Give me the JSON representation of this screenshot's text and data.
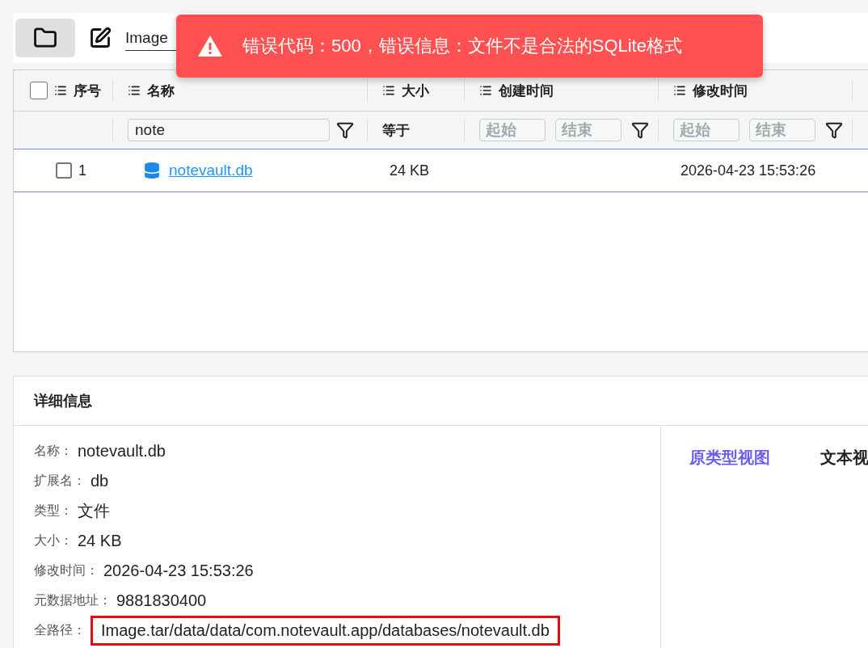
{
  "toolbar": {
    "buttons": [
      {
        "kind": "folder",
        "selected": true
      },
      {
        "kind": "edit",
        "selected": false
      }
    ],
    "path_field": {
      "value": "Image"
    }
  },
  "toast": {
    "kind": "error",
    "message": "错误代码：500，错误信息：文件不是合法的SQLite格式"
  },
  "table": {
    "select_all": {
      "checked": false
    },
    "columns": [
      {
        "label": "序号"
      },
      {
        "label": "名称"
      },
      {
        "label": "大小"
      },
      {
        "label": "创建时间"
      },
      {
        "label": "修改时间"
      }
    ],
    "filters": [
      {
        "kind": "none"
      },
      {
        "kind": "text",
        "value": "note"
      },
      {
        "kind": "label",
        "text": "等于"
      },
      {
        "kind": "range",
        "start_placeholder": "起始",
        "end_placeholder": "结束"
      },
      {
        "kind": "range",
        "start_placeholder": "起始",
        "end_placeholder": "结束"
      }
    ],
    "rows": [
      {
        "index": "1",
        "checked": false,
        "selected": true,
        "name": "notevault.db",
        "size": "24 KB",
        "modified": "2026-04-23 15:53:26"
      }
    ]
  },
  "details": {
    "title": "详细信息",
    "fields": [
      {
        "label": "名称：",
        "value": "notevault.db",
        "highlighted": false
      },
      {
        "label": "扩展名：",
        "value": "db",
        "highlighted": false
      },
      {
        "label": "类型：",
        "value": "文件",
        "highlighted": false
      },
      {
        "label": "大小：",
        "value": "24 KB",
        "highlighted": false
      },
      {
        "label": "修改时间：",
        "value": "2026-04-23 15:53:26",
        "highlighted": false
      },
      {
        "label": "元数据地址：",
        "value": "9881830400",
        "highlighted": false
      },
      {
        "label": "全路径：",
        "value": "Image.tar/data/data/com.notevault.app/databases/notevault.db",
        "highlighted": true
      }
    ],
    "tabs": [
      {
        "label": "原类型视图",
        "selected": true
      },
      {
        "label": "文本视",
        "selected": false
      }
    ]
  }
}
